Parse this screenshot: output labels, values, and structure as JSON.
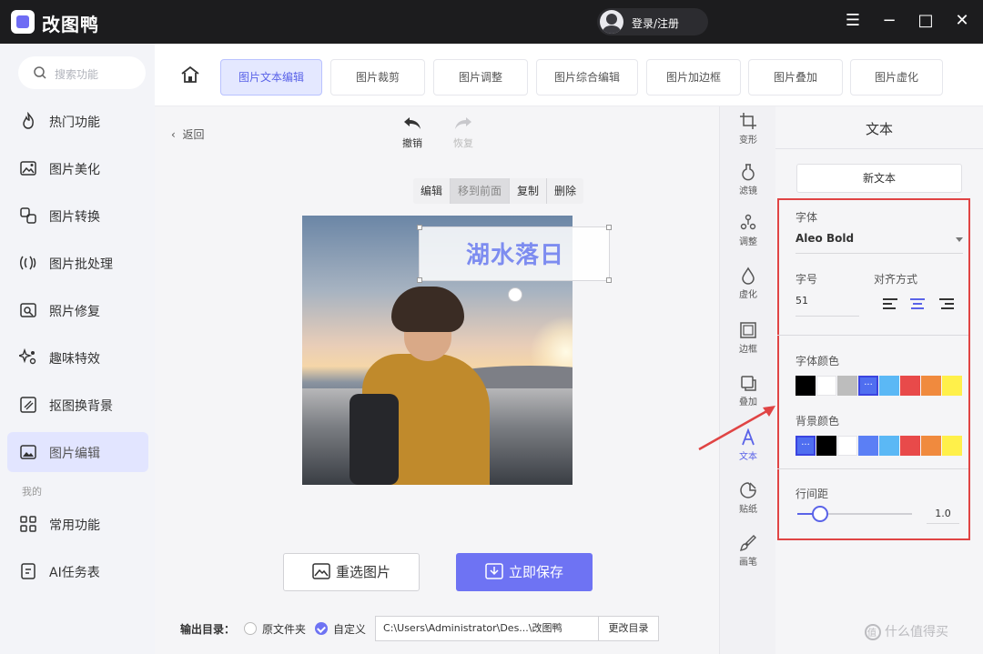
{
  "app": {
    "name": "改图鸭",
    "login": "登录/注册"
  },
  "window_controls": {
    "menu": "☰",
    "minimize": "−",
    "maximize": "□",
    "close": "✕"
  },
  "sidebar": {
    "search_placeholder": "搜索功能",
    "items": [
      {
        "label": "热门功能",
        "icon": "fire-icon"
      },
      {
        "label": "图片美化",
        "icon": "image-beautify-icon"
      },
      {
        "label": "图片转换",
        "icon": "convert-icon"
      },
      {
        "label": "图片批处理",
        "icon": "batch-icon"
      },
      {
        "label": "照片修复",
        "icon": "photo-repair-icon"
      },
      {
        "label": "趣味特效",
        "icon": "sparkle-icon"
      },
      {
        "label": "抠图换背景",
        "icon": "cutout-icon"
      },
      {
        "label": "图片编辑",
        "icon": "image-edit-icon",
        "active": true
      }
    ],
    "section_mine": "我的",
    "mine_items": [
      {
        "label": "常用功能",
        "icon": "grid-icon"
      },
      {
        "label": "AI任务表",
        "icon": "task-list-icon"
      }
    ]
  },
  "tabs": [
    {
      "label": "图片文本编辑",
      "active": true
    },
    {
      "label": "图片裁剪"
    },
    {
      "label": "图片调整"
    },
    {
      "label": "图片综合编辑"
    },
    {
      "label": "图片加边框"
    },
    {
      "label": "图片叠加"
    },
    {
      "label": "图片虚化"
    }
  ],
  "editor": {
    "back": "返回",
    "undo": "撤销",
    "redo": "恢复",
    "context_menu": [
      "编辑",
      "移到前面",
      "复制",
      "删除"
    ],
    "context_menu_active": "移到前面",
    "text_overlay": "湖水落日",
    "reselect": "重选图片",
    "save": "立即保存",
    "output": {
      "label": "输出目录：",
      "option_original": "原文件夹",
      "option_custom": "自定义",
      "selected": "自定义",
      "path": "C:\\Users\\Administrator\\Des...\\改图鸭",
      "change": "更改目录"
    }
  },
  "tools": [
    {
      "label": "变形",
      "icon": "transform-icon"
    },
    {
      "label": "滤镜",
      "icon": "filter-icon"
    },
    {
      "label": "调整",
      "icon": "adjust-icon"
    },
    {
      "label": "虚化",
      "icon": "blur-drop-icon"
    },
    {
      "label": "边框",
      "icon": "frame-icon"
    },
    {
      "label": "叠加",
      "icon": "overlay-icon"
    },
    {
      "label": "文本",
      "icon": "text-a-icon",
      "active": true
    },
    {
      "label": "贴纸",
      "icon": "sticker-icon"
    },
    {
      "label": "画笔",
      "icon": "brush-icon"
    }
  ],
  "text_panel": {
    "title": "文本",
    "new_text": "新文本",
    "font_label": "字体",
    "font_value": "Aleo Bold",
    "size_label": "字号",
    "size_value": "51",
    "align_label": "对齐方式",
    "align_selected": "center",
    "font_color_label": "字体颜色",
    "font_colors": [
      "#000000",
      "#ffffff",
      "#bdbdbd",
      "#4f6ef0",
      "#5bb8f5",
      "#e84a4a",
      "#f08a3e",
      "#fff04a"
    ],
    "font_color_selected": 3,
    "bg_color_label": "背景颜色",
    "bg_colors": [
      "#4f6ef0",
      "#000000",
      "#ffffff",
      "#5b7ff5",
      "#5bb8f5",
      "#e84a4a",
      "#f08a3e",
      "#fff04a"
    ],
    "bg_color_selected": 0,
    "line_spacing_label": "行间距",
    "line_spacing_value": "1.0",
    "line_spacing_fraction": 0.2
  },
  "watermark": "什么值得买"
}
